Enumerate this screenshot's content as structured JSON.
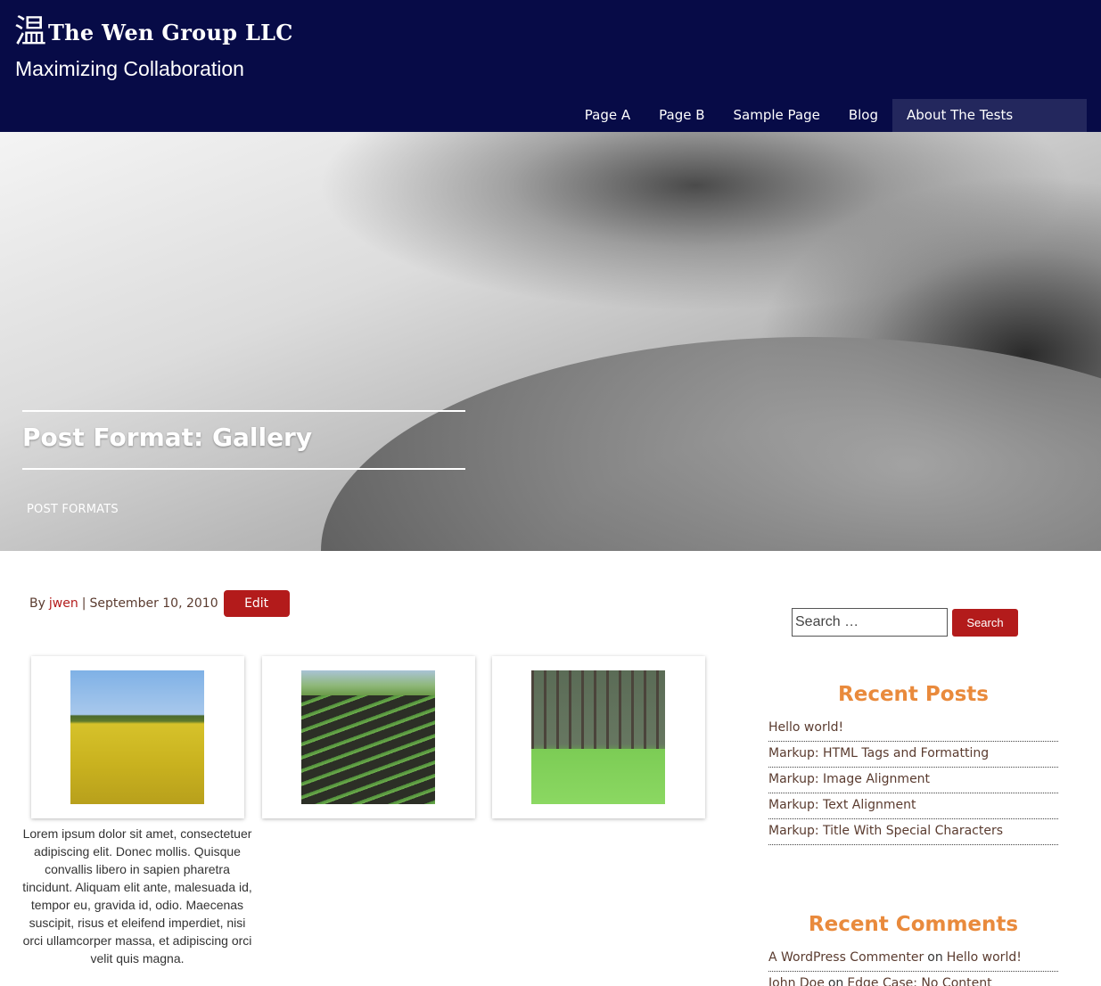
{
  "header": {
    "logo_glyph": "温",
    "site_name": "The Wen Group LLC",
    "tagline": "Maximizing Collaboration",
    "bg_color": "#070b47"
  },
  "nav": {
    "items": [
      {
        "label": "Page A"
      },
      {
        "label": "Page B"
      },
      {
        "label": "Sample Page"
      },
      {
        "label": "Blog"
      },
      {
        "label": "About The Tests"
      }
    ]
  },
  "hero": {
    "title": "Post Format: Gallery",
    "category": "POST FORMATS"
  },
  "meta": {
    "by": "By",
    "author": "jwen",
    "separator": "|",
    "date": "September 10, 2010",
    "edit_label": "Edit"
  },
  "gallery": {
    "caption": "Lorem ipsum dolor sit amet, consectetuer adipiscing elit. Donec mollis. Quisque convallis libero in sapien pharetra tincidunt. Aliquam elit ante, malesuada id, tempor eu, gravida id, odio. Maecenas suscipit, risus et eleifend imperdiet, nisi orci ullamcorper massa, et adipiscing orci velit quis magna."
  },
  "sidebar": {
    "search": {
      "placeholder": "Search …",
      "button_label": "Search"
    },
    "recent_posts": {
      "title": "Recent Posts",
      "items": [
        "Hello world!",
        "Markup: HTML Tags and Formatting",
        "Markup: Image Alignment",
        "Markup: Text Alignment",
        "Markup: Title With Special Characters"
      ]
    },
    "recent_comments": {
      "title": "Recent Comments",
      "items": [
        {
          "author": "A WordPress Commenter",
          "on": "on",
          "post": "Hello world!"
        },
        {
          "author": "John Doe",
          "on": "on",
          "post": "Edge Case: No Content"
        }
      ]
    }
  },
  "colors": {
    "accent_red": "#b31b1b",
    "widget_title": "#e98a3c"
  }
}
